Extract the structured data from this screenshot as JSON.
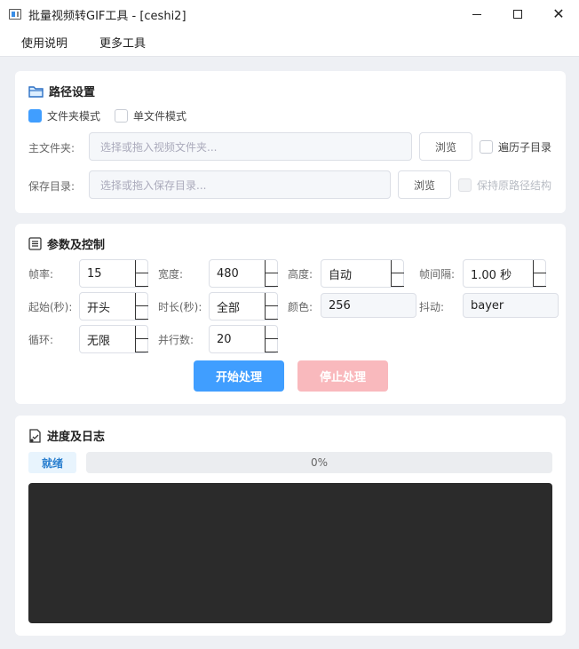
{
  "window": {
    "title": "批量视频转GIF工具 - [ceshi2]"
  },
  "menu": {
    "items": [
      "使用说明",
      "更多工具"
    ]
  },
  "path_card": {
    "title": "路径设置",
    "mode_folder": "文件夹模式",
    "mode_single": "单文件模式",
    "main_label": "主文件夹:",
    "main_placeholder": "选择或拖入视频文件夹...",
    "browse1": "浏览",
    "traverse": "遍历子目录",
    "save_label": "保存目录:",
    "save_placeholder": "选择或拖入保存目录...",
    "browse2": "浏览",
    "keep_structure": "保持原路径结构",
    "folder_checked": true,
    "single_checked": false,
    "traverse_checked": false,
    "keep_checked": false
  },
  "params_card": {
    "title": "参数及控制",
    "fps_label": "帧率:",
    "fps_value": "15",
    "width_label": "宽度:",
    "width_value": "480",
    "height_label": "高度:",
    "height_value": "自动",
    "interval_label": "帧间隔:",
    "interval_value": "1.00 秒",
    "start_label": "起始(秒):",
    "start_value": "开头",
    "duration_label": "时长(秒):",
    "duration_value": "全部",
    "color_label": "颜色:",
    "color_value": "256",
    "dither_label": "抖动:",
    "dither_value": "bayer",
    "loop_label": "循环:",
    "loop_value": "无限",
    "parallel_label": "并行数:",
    "parallel_value": "20",
    "start_button": "开始处理",
    "stop_button": "停止处理"
  },
  "progress_card": {
    "title": "进度及日志",
    "status": "就绪",
    "progress_text": "0%",
    "progress_fraction": 0
  },
  "colors": {
    "accent": "#409eff",
    "stop_disabled": "#f9b9bd",
    "log_bg": "#2b2b2b"
  }
}
